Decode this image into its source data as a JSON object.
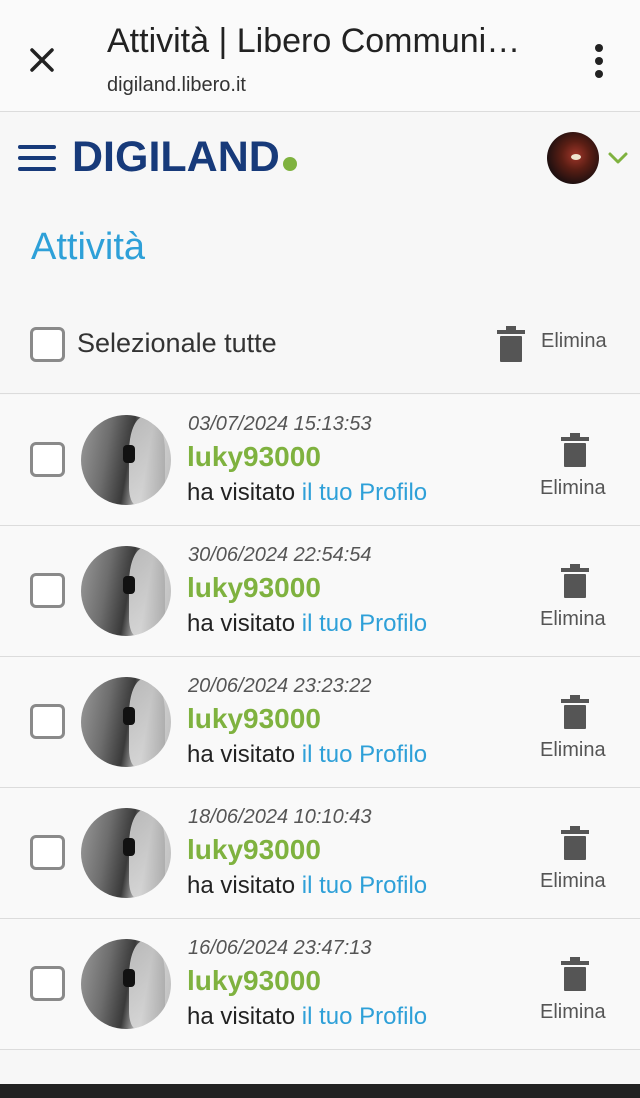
{
  "browser": {
    "title": "Attività | Libero Communi…",
    "url": "digiland.libero.it"
  },
  "header": {
    "logo_text": "DIGILAND",
    "icons": {
      "menu": "hamburger-icon",
      "account": "chevron-down-icon"
    }
  },
  "page": {
    "title": "Attività",
    "select_all_label": "Selezionale tutte",
    "delete_label": "Elimina"
  },
  "activities": [
    {
      "date": "03/07/2024 15:13:53",
      "user": "luky93000",
      "action": "ha visitato",
      "link": "il tuo Profilo",
      "delete_label": "Elimina"
    },
    {
      "date": "30/06/2024 22:54:54",
      "user": "luky93000",
      "action": "ha visitato",
      "link": "il tuo Profilo",
      "delete_label": "Elimina"
    },
    {
      "date": "20/06/2024 23:23:22",
      "user": "luky93000",
      "action": "ha visitato",
      "link": "il tuo Profilo",
      "delete_label": "Elimina"
    },
    {
      "date": "18/06/2024 10:10:43",
      "user": "luky93000",
      "action": "ha visitato",
      "link": "il tuo Profilo",
      "delete_label": "Elimina"
    },
    {
      "date": "16/06/2024 23:47:13",
      "user": "luky93000",
      "action": "ha visitato",
      "link": "il tuo Profilo",
      "delete_label": "Elimina"
    }
  ],
  "colors": {
    "brand_blue": "#173a7a",
    "accent_green": "#7fb23f",
    "link_blue": "#2ea0d8"
  }
}
